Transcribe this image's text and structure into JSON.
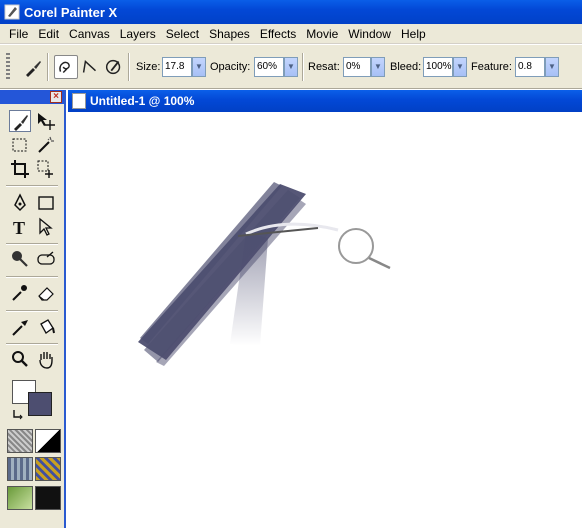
{
  "window": {
    "title": "Corel Painter X"
  },
  "menu": [
    "File",
    "Edit",
    "Canvas",
    "Layers",
    "Select",
    "Shapes",
    "Effects",
    "Movie",
    "Window",
    "Help"
  ],
  "property_bar": {
    "size_label": "Size:",
    "size_value": "17.8",
    "opacity_label": "Opacity:",
    "opacity_value": "60%",
    "resat_label": "Resat:",
    "resat_value": "0%",
    "bleed_label": "Bleed:",
    "bleed_value": "100%",
    "feature_label": "Feature:",
    "feature_value": "0.8"
  },
  "document": {
    "title": "Untitled-1 @ 100%"
  },
  "colors": {
    "main_color": "#ffffff",
    "additional_color": "#4d4e70",
    "title_bar": "#0348d6",
    "stroke": "#4d4e70"
  }
}
